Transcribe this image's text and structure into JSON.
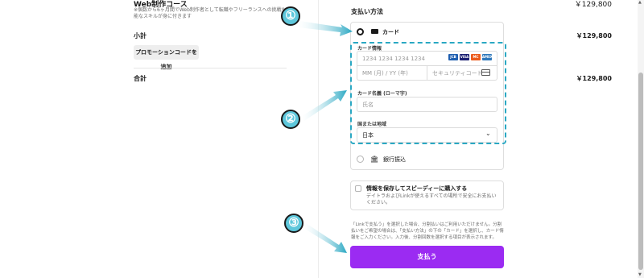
{
  "summary": {
    "product_name": "Web制作コース",
    "product_price": "￥129,800",
    "product_desc": "※個数から6ヶ月間でWeb制作者として転職やフリーランスへの挑戦も可能なスキルが身に付きます",
    "subtotal_label": "小計",
    "subtotal_value": "￥129,800",
    "promo_button": "プロモーションコードを追加",
    "total_label": "合計",
    "total_value": "￥129,800"
  },
  "payment": {
    "section_title": "支払い方法",
    "card_option_label": "カード",
    "card_info_label": "カード情報",
    "card_number_placeholder": "1234 1234 1234 1234",
    "expiry_placeholder": "MM (月) / YY (年)",
    "cvc_placeholder": "セキュリティコード",
    "cardholder_label": "カード名義 (ローマ字)",
    "cardholder_placeholder": "氏名",
    "country_label": "国または地域",
    "country_value": "日本",
    "bank_option_label": "銀行振込",
    "brands": [
      {
        "name": "JCB",
        "color": "#1f5fb0"
      },
      {
        "name": "VISA",
        "color": "#1a1f71"
      },
      {
        "name": "MC",
        "color": "#eb5a1b"
      },
      {
        "name": "AMEX",
        "color": "#2e77bb"
      }
    ]
  },
  "save": {
    "title": "情報を保存してスピーディーに購入する",
    "desc": "デイトラおよびLinkが使えるすべての場所で安全にお支払いください。"
  },
  "notice": "「Linkで支払う」を選択した場合、分割払いはご利用いただけません。分割払いをご希望の場合は、「支払い方法」の下の「カード」を選択し、カード情報をご入力ください。入力後、分割回数を選択する項目が表示されます。",
  "pay_button": "支払う",
  "callouts": [
    "①",
    "②",
    "③"
  ],
  "colors": {
    "pay_button": "#9b2bf2",
    "callout": "#5ec7db",
    "dash": "#2aa8c3"
  }
}
